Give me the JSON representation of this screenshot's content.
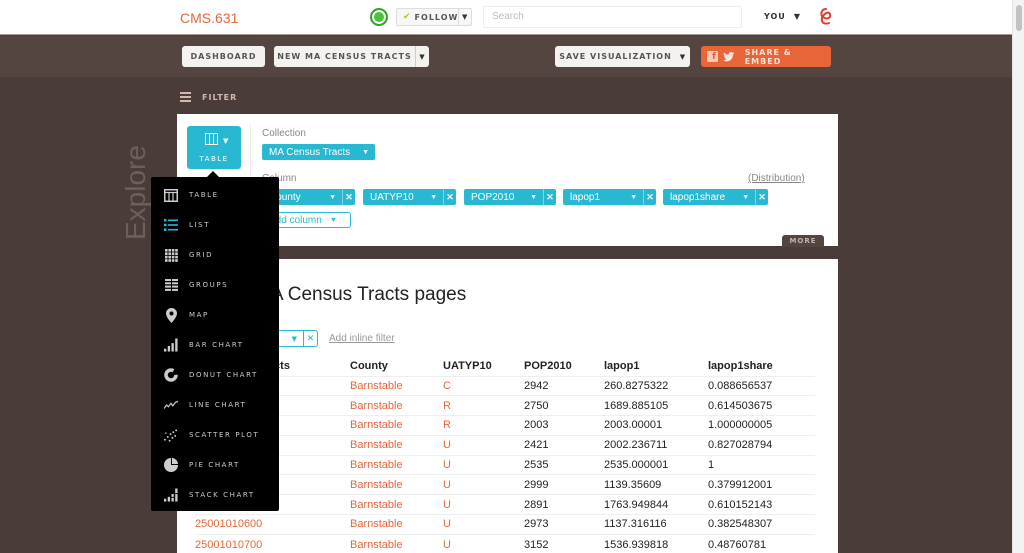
{
  "header": {
    "brand": "CMS.631",
    "follow_label": "FOLLOW",
    "search_placeholder": "Search",
    "user_label": "YOU",
    "status_color": "#4cc13c"
  },
  "toolbar": {
    "dashboard_label": "DASHBOARD",
    "dataset_label": "NEW MA CENSUS TRACTS",
    "save_label": "SAVE VISUALIZATION",
    "share_label": "SHARE & EMBED",
    "accent_color": "#e8653a"
  },
  "filter": {
    "label": "FILTER"
  },
  "side_label": "Explore",
  "config": {
    "type_label": "TABLE",
    "collection_label": "Collection",
    "collection_value": "MA Census Tracts",
    "column_label": "Column",
    "columns": [
      "County",
      "UATYP10",
      "POP2010",
      "lapop1",
      "lapop1share"
    ],
    "add_column_label": "Add column",
    "distribution_label": "(Distribution)",
    "more_label": "MORE",
    "accent_color": "#29b8d2"
  },
  "viz_menu": {
    "items": [
      {
        "label": "TABLE",
        "icon": "table-icon"
      },
      {
        "label": "LIST",
        "icon": "list-icon"
      },
      {
        "label": "GRID",
        "icon": "grid-icon"
      },
      {
        "label": "GROUPS",
        "icon": "groups-icon"
      },
      {
        "label": "MAP",
        "icon": "map-pin-icon"
      },
      {
        "label": "BAR CHART",
        "icon": "bar-chart-icon"
      },
      {
        "label": "DONUT CHART",
        "icon": "donut-chart-icon"
      },
      {
        "label": "LINE CHART",
        "icon": "line-chart-icon"
      },
      {
        "label": "SCATTER PLOT",
        "icon": "scatter-plot-icon"
      },
      {
        "label": "PIE CHART",
        "icon": "pie-chart-icon"
      },
      {
        "label": "STACK CHART",
        "icon": "stack-chart-icon"
      }
    ]
  },
  "page": {
    "title": "MA Census Tracts pages",
    "add_inline_filter_label": "Add inline filter",
    "table": {
      "columns": [
        "MA Census Tracts",
        "County",
        "UATYP10",
        "POP2010",
        "lapop1",
        "lapop1share"
      ],
      "rows": [
        [
          "",
          "Barnstable",
          "C",
          "2942",
          "260.8275322",
          "0.088656537"
        ],
        [
          "",
          "Barnstable",
          "R",
          "2750",
          "1689.885105",
          "0.614503675"
        ],
        [
          "",
          "Barnstable",
          "R",
          "2003",
          "2003.00001",
          "1.000000005"
        ],
        [
          "",
          "Barnstable",
          "U",
          "2421",
          "2002.236711",
          "0.827028794"
        ],
        [
          "",
          "Barnstable",
          "U",
          "2535",
          "2535.000001",
          "1"
        ],
        [
          "",
          "Barnstable",
          "U",
          "2999",
          "1139.35609",
          "0.379912001"
        ],
        [
          "",
          "Barnstable",
          "U",
          "2891",
          "1763.949844",
          "0.610152143"
        ],
        [
          "25001010600",
          "Barnstable",
          "U",
          "2973",
          "1137.316116",
          "0.382548307"
        ],
        [
          "25001010700",
          "Barnstable",
          "U",
          "3152",
          "1536.939818",
          "0.48760781"
        ]
      ]
    }
  }
}
